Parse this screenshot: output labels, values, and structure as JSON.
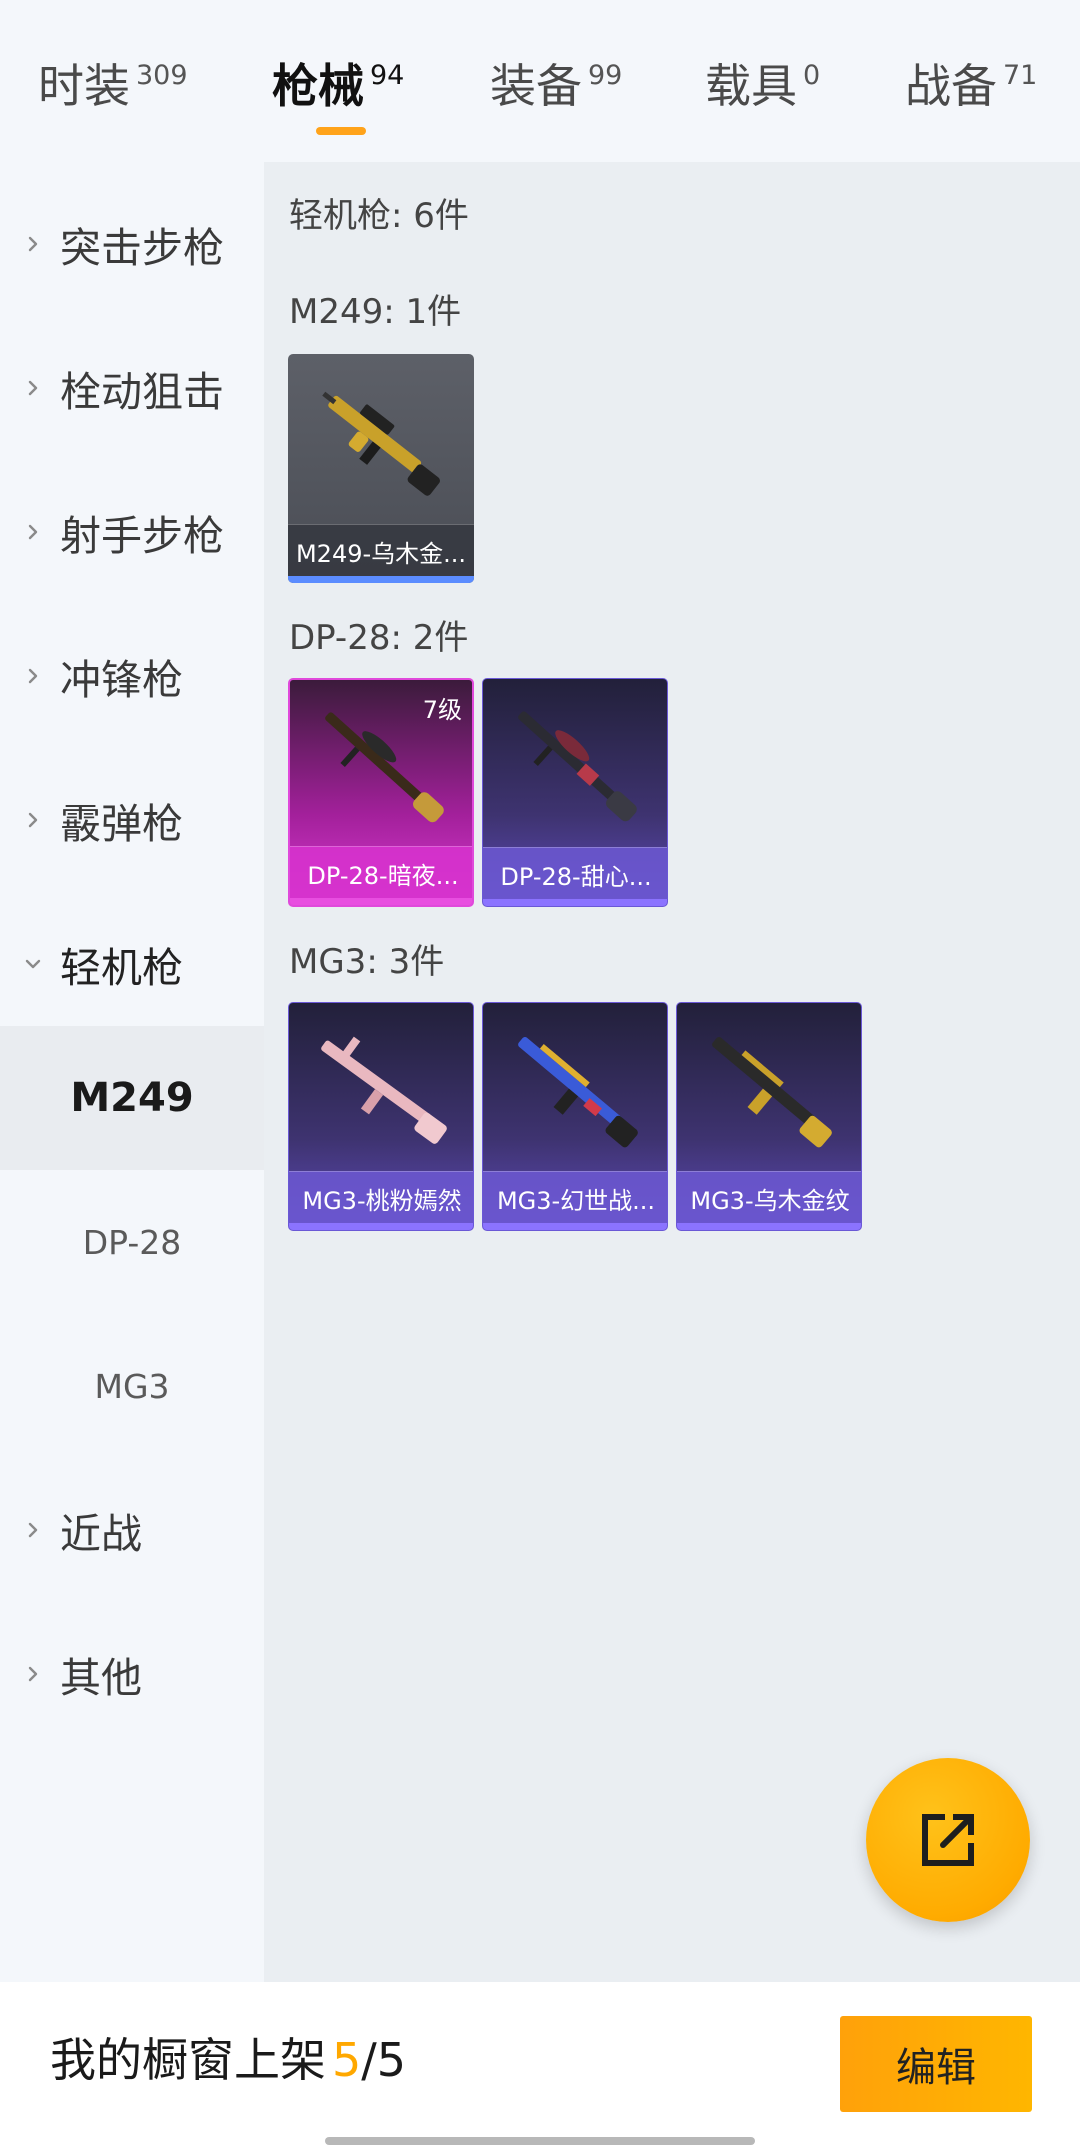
{
  "tabs": [
    {
      "label": "时装",
      "count": "309"
    },
    {
      "label": "枪械",
      "count": "94"
    },
    {
      "label": "装备",
      "count": "99"
    },
    {
      "label": "载具",
      "count": "0"
    },
    {
      "label": "战备",
      "count": "71"
    }
  ],
  "sidebar": {
    "categories": [
      {
        "label": "突击步枪"
      },
      {
        "label": "栓动狙击"
      },
      {
        "label": "射手步枪"
      },
      {
        "label": "冲锋枪"
      },
      {
        "label": "霰弹枪"
      },
      {
        "label": "轻机枪"
      },
      {
        "label": "近战"
      },
      {
        "label": "其他"
      }
    ],
    "subitems": [
      {
        "label": "M249"
      },
      {
        "label": "DP-28"
      },
      {
        "label": "MG3"
      }
    ]
  },
  "main": {
    "header": "轻机枪: 6件",
    "groups": [
      {
        "title": "M249: 1件",
        "items": [
          {
            "name": "M249-乌木金..."
          }
        ]
      },
      {
        "title": "DP-28: 2件",
        "items": [
          {
            "name": "DP-28-暗夜...",
            "level": "7级"
          },
          {
            "name": "DP-28-甜心..."
          }
        ]
      },
      {
        "title": "MG3: 3件",
        "items": [
          {
            "name": "MG3-桃粉嫣然"
          },
          {
            "name": "MG3-幻世战..."
          },
          {
            "name": "MG3-乌木金纹"
          }
        ]
      }
    ]
  },
  "footer": {
    "showcase_label": "我的橱窗上架",
    "showcase_current": "5",
    "showcase_total": "/5",
    "edit_label": "编辑"
  },
  "colors": {
    "accent": "#ffa800",
    "rarity_blue": "#5b8cff",
    "rarity_pink": "#e049db",
    "rarity_purple": "#6a58d6"
  }
}
